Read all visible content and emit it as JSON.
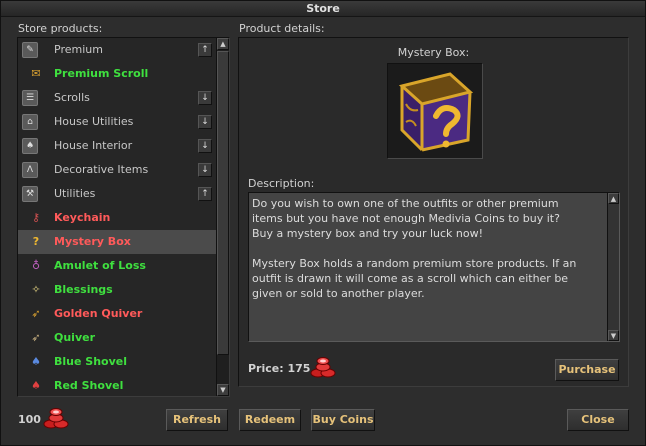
{
  "window": {
    "title": "Store"
  },
  "left": {
    "section_label": "Store products:",
    "items": [
      {
        "type": "category",
        "label": "Premium",
        "icon": "premium-icon",
        "toggle": "↑"
      },
      {
        "type": "product",
        "label": "Premium Scroll",
        "icon": "scroll-icon",
        "color": "#3fe03f"
      },
      {
        "type": "category",
        "label": "Scrolls",
        "icon": "scrolls-icon",
        "toggle": "↓"
      },
      {
        "type": "category",
        "label": "House Utilities",
        "icon": "house-utilities-icon",
        "toggle": "↓"
      },
      {
        "type": "category",
        "label": "House Interior",
        "icon": "house-interior-icon",
        "toggle": "↓"
      },
      {
        "type": "category",
        "label": "Decorative Items",
        "icon": "decorative-icon",
        "toggle": "↓"
      },
      {
        "type": "category",
        "label": "Utilities",
        "icon": "utilities-icon",
        "toggle": "↑"
      },
      {
        "type": "product",
        "label": "Keychain",
        "icon": "keychain-icon",
        "color": "#ff5a5a"
      },
      {
        "type": "product",
        "label": "Mystery Box",
        "icon": "mystery-box-icon",
        "color": "#ff5a5a",
        "selected": true
      },
      {
        "type": "product",
        "label": "Amulet of Loss",
        "icon": "amulet-icon",
        "color": "#3fe03f"
      },
      {
        "type": "product",
        "label": "Blessings",
        "icon": "blessings-icon",
        "color": "#3fe03f"
      },
      {
        "type": "product",
        "label": "Golden Quiver",
        "icon": "golden-quiver-icon",
        "color": "#ff5a5a"
      },
      {
        "type": "product",
        "label": "Quiver",
        "icon": "quiver-icon",
        "color": "#3fe03f"
      },
      {
        "type": "product",
        "label": "Blue Shovel",
        "icon": "blue-shovel-icon",
        "color": "#3fe03f"
      },
      {
        "type": "product",
        "label": "Red Shovel",
        "icon": "red-shovel-icon",
        "color": "#3fe03f"
      }
    ]
  },
  "details": {
    "section_label": "Product details:",
    "product_name": "Mystery Box:",
    "description_label": "Description:",
    "description": "Do you wish to own one of the outfits or other premium\nitems but you have not enough Medivia Coins to buy it?\nBuy a mystery box and try your luck now!\n\nMystery Box holds a random premium store products. If an\noutfit is drawn it will come as a scroll which can either be\ngiven or sold to another player.",
    "price_label": "Price: 175",
    "purchase_label": "Purchase"
  },
  "footer": {
    "coins": "100",
    "refresh_label": "Refresh",
    "redeem_label": "Redeem",
    "buy_coins_label": "Buy Coins",
    "close_label": "Close"
  },
  "colors": {
    "button_text": "#e6c27a",
    "affordable": "#3fe03f",
    "unaffordable": "#ff5a5a"
  }
}
